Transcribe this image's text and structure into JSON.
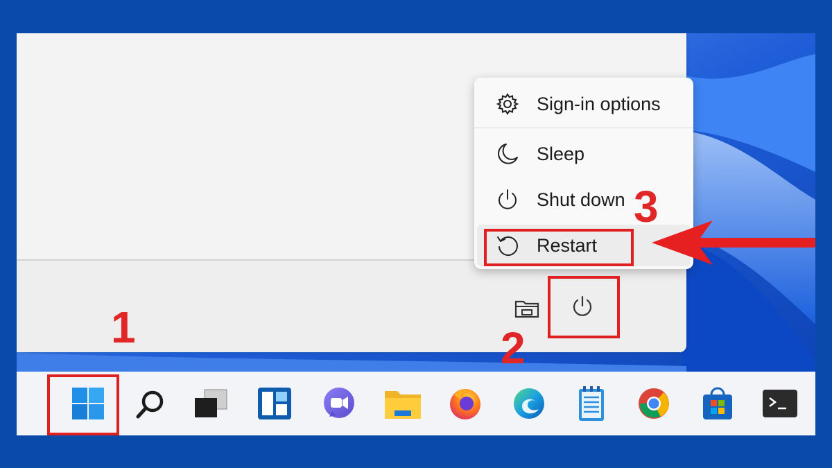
{
  "power_menu": {
    "items": [
      {
        "label": "Sign-in options",
        "icon": "gear-icon"
      },
      {
        "label": "Sleep",
        "icon": "moon-icon"
      },
      {
        "label": "Shut down",
        "icon": "power-icon"
      },
      {
        "label": "Restart",
        "icon": "restart-icon"
      }
    ]
  },
  "start_footer": {
    "icons": [
      "file-explorer-icon",
      "power-icon"
    ]
  },
  "taskbar": {
    "icons": [
      "start-icon",
      "search-icon",
      "task-view-icon",
      "widgets-icon",
      "chat-icon",
      "file-explorer-icon",
      "firefox-icon",
      "edge-icon",
      "notepad-icon",
      "chrome-icon",
      "microsoft-store-icon",
      "terminal-icon"
    ]
  },
  "annotations": {
    "step_1": "1",
    "step_2": "2",
    "step_3": "3",
    "color": "#e02626"
  },
  "colors": {
    "frame": "#0a4aa8",
    "wallpaper": "#1d5fcf",
    "accent_red": "#e02020"
  }
}
